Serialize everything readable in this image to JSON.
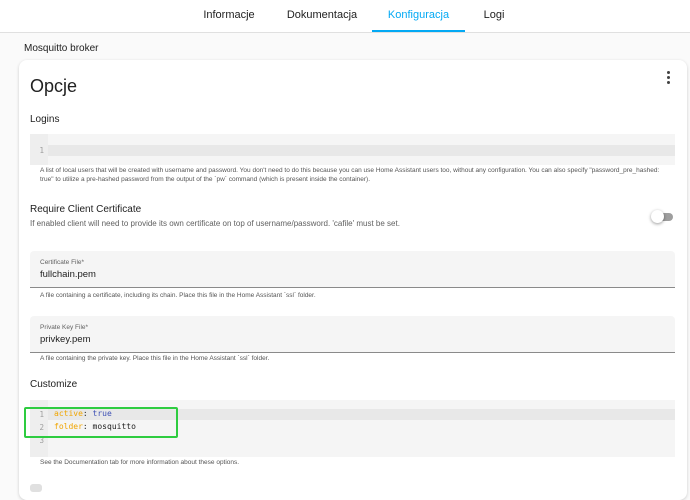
{
  "tabs": [
    {
      "label": "Informacje",
      "active": false
    },
    {
      "label": "Dokumentacja",
      "active": false
    },
    {
      "label": "Konfiguracja",
      "active": true
    },
    {
      "label": "Logi",
      "active": false
    }
  ],
  "section_title": "Mosquitto broker",
  "card": {
    "title": "Opcje",
    "menu_icon": "kebab-menu-icon",
    "logins": {
      "label": "Logins",
      "lines": [
        "1"
      ],
      "helper": "A list of local users that will be created with username and password. You don't need to do this because you can use Home Assistant users too, without any configuration. You can also specify \"password_pre_hashed: true\" to utilize a pre-hashed password from the output of the `pw` command (which is present inside the container)."
    },
    "client_cert": {
      "label": "Require Client Certificate",
      "description": "If enabled client will need to provide its own certificate on top of username/password. 'cafile' must be set.",
      "enabled": false
    },
    "certfile": {
      "label": "Certificate File*",
      "value": "fullchain.pem",
      "helper": "A file containing a certificate, including its chain. Place this file in the Home Assistant `ssl` folder."
    },
    "keyfile": {
      "label": "Private Key File*",
      "value": "privkey.pem",
      "helper": "A file containing the private key. Place this file in the Home Assistant `ssl` folder."
    },
    "customize": {
      "label": "Customize",
      "line_numbers": [
        "1",
        "2",
        "3"
      ],
      "line1_key": "active",
      "line1_sep": ": ",
      "line1_val": "true",
      "line2_key": "folder",
      "line2_sep": ": ",
      "line2_val": "mosquitto",
      "helper": "See the Documentation tab for more information about these options."
    }
  },
  "colors": {
    "accent": "#03a9f4",
    "highlight_box": "#2ecc40",
    "yaml_key": "#f0a500",
    "yaml_bool": "#3f51b5"
  }
}
